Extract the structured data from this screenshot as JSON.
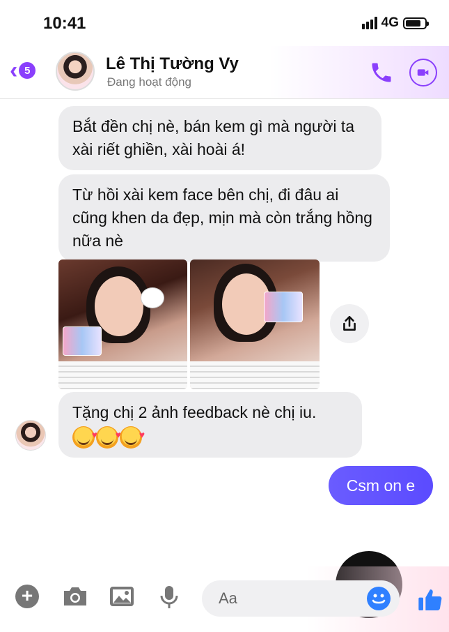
{
  "status_bar": {
    "time": "10:41",
    "network": "4G",
    "battery_level": 0.8
  },
  "header": {
    "back_badge_count": "5",
    "contact_name": "Lê Thị Tường Vy",
    "contact_status": "Đang hoạt động"
  },
  "messages": [
    {
      "direction": "incoming",
      "text": "Bắt đền chị nè, bán kem gì mà người ta xài riết ghiền, xài hoài á!"
    },
    {
      "direction": "incoming",
      "text": "Từ hồi xài kem face bên chị, đi đâu ai cũng khen da đẹp, mịn mà còn trắng hồng nữa nè"
    },
    {
      "direction": "incoming",
      "text": "Tặng chị 2 ảnh feedback nè chị iu."
    },
    {
      "direction": "outgoing",
      "text": "Csm on e"
    }
  ],
  "composer": {
    "placeholder": "Aa"
  },
  "colors": {
    "accent": "#8a3ffc",
    "outgoing_bubble": "#5b4bff",
    "incoming_bubble": "#ececee",
    "like_blue": "#2f80ff"
  },
  "icons": [
    "chevron-left-icon",
    "phone-icon",
    "video-camera-icon",
    "share-icon",
    "plus-icon",
    "camera-icon",
    "gallery-icon",
    "microphone-icon",
    "emoji-icon",
    "thumbs-up-icon"
  ]
}
